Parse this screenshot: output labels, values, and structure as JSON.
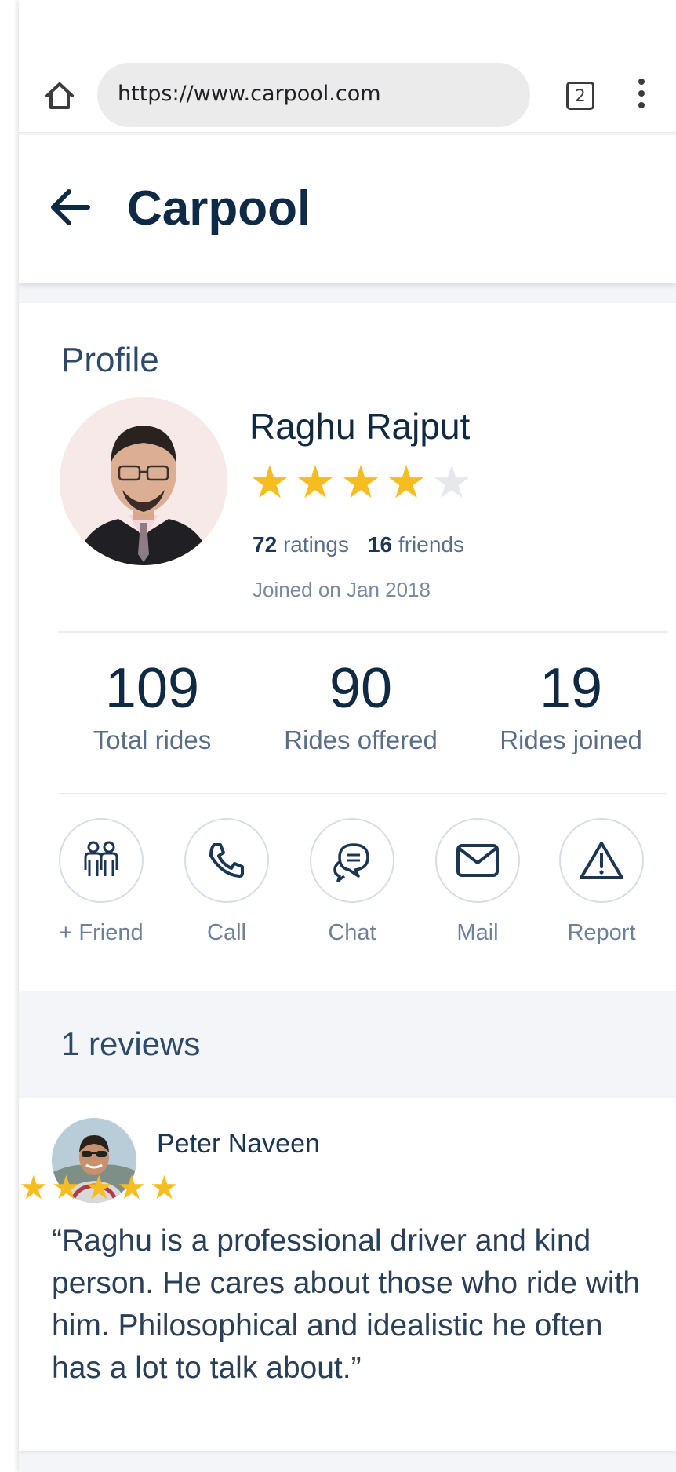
{
  "browser": {
    "url": "https://www.carpool.com",
    "tab_count": "2"
  },
  "app_bar": {
    "title": "Carpool"
  },
  "profile": {
    "section_label": "Profile",
    "name": "Raghu Rajput",
    "rating_stars": 4,
    "rating_max": 5,
    "ratings_count": "72",
    "ratings_label": "ratings",
    "friends_count": "16",
    "friends_label": "friends",
    "joined": "Joined on Jan 2018"
  },
  "stats": [
    {
      "value": "109",
      "label": "Total rides"
    },
    {
      "value": "90",
      "label": "Rides offered"
    },
    {
      "value": "19",
      "label": "Rides joined"
    }
  ],
  "actions": [
    {
      "label": "+ Friend",
      "icon": "add-friend-icon"
    },
    {
      "label": "Call",
      "icon": "phone-icon"
    },
    {
      "label": "Chat",
      "icon": "chat-icon"
    },
    {
      "label": "Mail",
      "icon": "mail-icon"
    },
    {
      "label": "Report",
      "icon": "warning-icon"
    }
  ],
  "reviews": {
    "title": "1 reviews",
    "items": [
      {
        "name": "Peter Naveen",
        "stars": 5,
        "text": "“Raghu is a professional driver and kind person. He cares about those who ride with him. Philosophical and idealistic he often has a lot to talk about.”"
      }
    ]
  },
  "colors": {
    "star": "#f5bd1f",
    "primary_text": "#0f2a47",
    "background": "#f3f5f8"
  }
}
